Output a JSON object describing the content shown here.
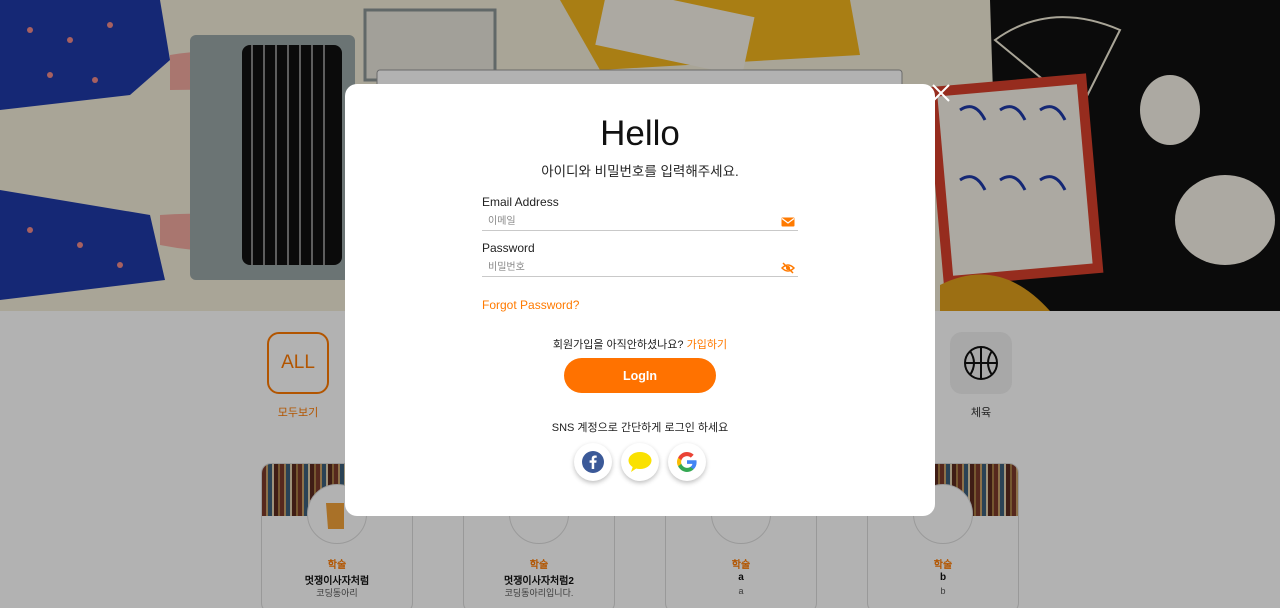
{
  "modal": {
    "title": "Hello",
    "subtitle": "아이디와 비밀번호를 입력해주세요.",
    "email_label": "Email Address",
    "email_placeholder": "이메일",
    "password_label": "Password",
    "password_placeholder": "비밀번호",
    "forgot": "Forgot Password?",
    "signup_prompt": "회원가입을 아직안하셨나요?",
    "signup_link": "가입하기",
    "login_label": "LogIn",
    "sns_prompt": "SNS 계정으로 간단하게 로그인 하세요",
    "sns": [
      "facebook-icon",
      "kakaotalk-icon",
      "google-icon"
    ]
  },
  "categories": [
    {
      "tile": "ALL",
      "label": "모두보기"
    },
    {
      "tile": "basketball-icon",
      "label": "체육"
    }
  ],
  "cards": [
    {
      "category": "학술",
      "name": "멋쟁이사자처럼",
      "desc": "코딩동아리"
    },
    {
      "category": "학술",
      "name": "멋쟁이사자처럼2",
      "desc": "코딩동아리입니다."
    },
    {
      "category": "학술",
      "name": "a",
      "desc": "a"
    },
    {
      "category": "학술",
      "name": "b",
      "desc": "b"
    }
  ],
  "colors": {
    "accent": "#ff7200",
    "facebook": "#3b5998",
    "kakao": "#fae100"
  }
}
